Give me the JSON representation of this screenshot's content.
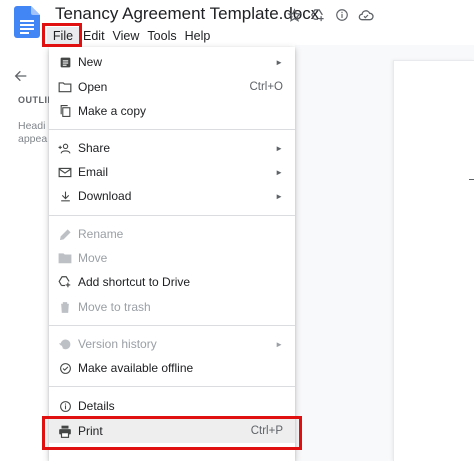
{
  "header": {
    "title": "Tenancy Agreement Template.docx",
    "title_icons": [
      "star-icon",
      "move-to-drive-icon",
      "info-icon",
      "cloud-status-icon"
    ]
  },
  "menubar": {
    "items": [
      "File",
      "Edit",
      "View",
      "Tools",
      "Help"
    ],
    "active": "File"
  },
  "outline": {
    "label": "OUTLIN",
    "hint_line1": "Headi",
    "hint_line2": "appea"
  },
  "file_menu": {
    "new": {
      "label": "New",
      "icon": "doc-icon",
      "submenu": "►"
    },
    "open": {
      "label": "Open",
      "icon": "folder-icon",
      "shortcut": "Ctrl+O"
    },
    "make_copy": {
      "label": "Make a copy",
      "icon": "copy-icon"
    },
    "share": {
      "label": "Share",
      "icon": "person-add-icon",
      "submenu": "►"
    },
    "email": {
      "label": "Email",
      "icon": "email-icon",
      "submenu": "►"
    },
    "download": {
      "label": "Download",
      "icon": "download-icon",
      "submenu": "►"
    },
    "rename": {
      "label": "Rename",
      "icon": "pencil-icon",
      "disabled": true
    },
    "move": {
      "label": "Move",
      "icon": "move-folder-icon",
      "disabled": true
    },
    "add_shortcut": {
      "label": "Add shortcut to Drive",
      "icon": "add-drive-icon"
    },
    "move_trash": {
      "label": "Move to trash",
      "icon": "trash-icon",
      "disabled": true
    },
    "version_history": {
      "label": "Version history",
      "icon": "history-icon",
      "disabled": true,
      "submenu": "►"
    },
    "offline": {
      "label": "Make available offline",
      "icon": "offline-check-icon"
    },
    "details": {
      "label": "Details",
      "icon": "info-icon"
    },
    "print": {
      "label": "Print",
      "icon": "printer-icon",
      "shortcut": "Ctrl+P"
    }
  },
  "colors": {
    "highlight_box": "#e01010",
    "docs_blue": "#4285f4",
    "menu_text": "#202124",
    "disabled_text": "#9aa0a6"
  }
}
